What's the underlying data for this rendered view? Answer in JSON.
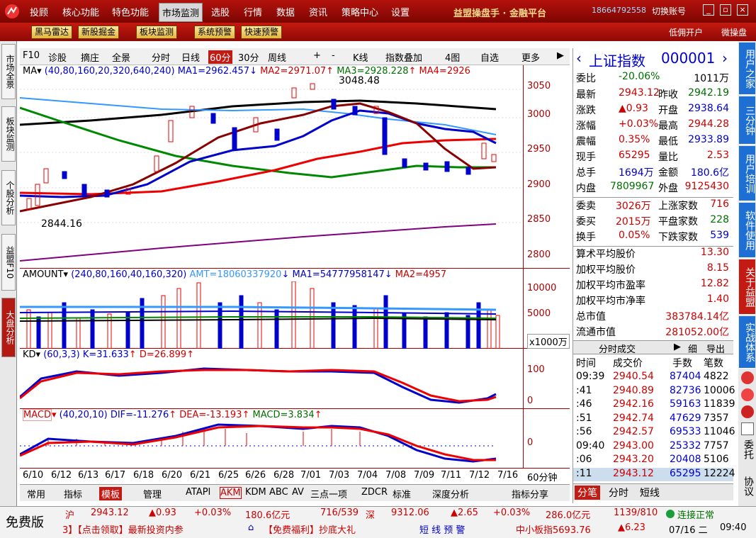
{
  "menu": {
    "items": [
      "投顾",
      "核心功能",
      "特色功能",
      "市场监测",
      "选股",
      "行情",
      "数据",
      "资讯",
      "策略中心",
      "设置"
    ],
    "brand": "益盟操盘手 · 金融平台",
    "phone": "18664792558",
    "switch": "切换账号"
  },
  "toolbar2": {
    "buttons": [
      "黑马雷达",
      "新股掘金",
      "板块监测",
      "系统预警",
      "快速预警"
    ],
    "right": [
      "低佣开户",
      "微操盘"
    ]
  },
  "lefttabs": [
    "市场全景",
    "板块监测",
    "个股分析",
    "益盟F10",
    "大盘分析"
  ],
  "charttool": {
    "items": [
      "F10",
      "诊股",
      "摘庄",
      "全景",
      "分时",
      "日线",
      "60分",
      "30分",
      "周线",
      "+",
      "-",
      "K线",
      "指数叠加",
      "4图",
      "自选",
      "更多"
    ]
  },
  "ma": {
    "label": "MA",
    "params": "(40,80,160,20,320,640,240)",
    "ma1": "MA1=2962.457",
    "ma2": "MA2=2971.07",
    "ma3": "MA3=2928.228",
    "ma4": "MA4=2926"
  },
  "price_axis": [
    "3050",
    "3000",
    "2950",
    "2900",
    "2850",
    "2800"
  ],
  "annot": {
    "high": "3048.48",
    "low": "2844.16"
  },
  "amount": {
    "label": "AMOUNT",
    "params": "(240,80,160,40,160,320)",
    "amt": "AMT=18060337920",
    "ma1": "MA1=54777958147",
    "ma2": "MA2=4957",
    "axis": [
      "10000",
      "5000"
    ],
    "unit": "x1000万"
  },
  "kd": {
    "label": "KD",
    "params": "(60,3,3)",
    "k": "K=31.633",
    "d": "D=26.899",
    "axis": [
      "100",
      "0"
    ]
  },
  "macd": {
    "label": "MACD",
    "params": "(40,20,10)",
    "dif": "DIF=-11.276",
    "dea": "DEA=-13.193",
    "macd": "MACD=3.834",
    "axis": [
      "0"
    ]
  },
  "dates": [
    "6/10",
    "6/12",
    "6/13",
    "6/17",
    "6/18",
    "6/20",
    "6/21",
    "6/25",
    "6/26",
    "6/28",
    "7/01",
    "7/03",
    "7/04",
    "7/08",
    "7/09",
    "7/11",
    "7/12",
    "7/16"
  ],
  "period": "60分钟",
  "chart_tabs": [
    "常用",
    "指标",
    "模板",
    "管理",
    "ATAPI",
    "AKM",
    "KDM",
    "ABC",
    "AV",
    "三点一项",
    "ZDCR",
    "标准",
    "深度分析",
    "指标分享"
  ],
  "quote": {
    "name": "上证指数",
    "code": "000001",
    "rows": [
      [
        "委比",
        "-20.06%",
        "",
        "1011万"
      ],
      [
        "最新",
        "2943.12",
        "昨收",
        "2942.19"
      ],
      [
        "涨跌",
        "▲0.93",
        "开盘",
        "2938.64"
      ],
      [
        "涨幅",
        "+0.03%",
        "最高",
        "2944.28"
      ],
      [
        "震幅",
        "0.35%",
        "最低",
        "2933.89"
      ],
      [
        "现手",
        "65295",
        "量比",
        "2.53"
      ],
      [
        "总手",
        "1694万",
        "金额",
        "180.6亿"
      ],
      [
        "内盘",
        "7809967",
        "外盘",
        "9125430"
      ],
      [
        "委卖",
        "3026万",
        "上涨家数",
        "716"
      ],
      [
        "委买",
        "2015万",
        "平盘家数",
        "228"
      ],
      [
        "换手",
        "0.05%",
        "下跌家数",
        "539"
      ]
    ],
    "stats": [
      [
        "算术平均股价",
        "13.30"
      ],
      [
        "加权平均股价",
        "8.15"
      ],
      [
        "加权平均市盈率",
        "12.82"
      ],
      [
        "加权平均市净率",
        "1.40"
      ],
      [
        "总市值",
        "383784.14亿"
      ],
      [
        "流通市值",
        "281052.00亿"
      ]
    ]
  },
  "ticks": {
    "title": "分时成交",
    "detail": "细",
    "export": "导出",
    "headers": [
      "时间",
      "成交价",
      "手数",
      "笔数"
    ],
    "rows": [
      [
        "09:39",
        "2940.54",
        "87404",
        "4822"
      ],
      [
        ":41",
        "2940.89",
        "82736",
        "10006"
      ],
      [
        ":46",
        "2942.16",
        "59163",
        "11839"
      ],
      [
        ":51",
        "2942.74",
        "47629",
        "7357"
      ],
      [
        ":56",
        "2942.57",
        "69533",
        "11046"
      ],
      [
        "09:40",
        "2943.00",
        "25332",
        "7757"
      ],
      [
        ":06",
        "2943.20",
        "20408",
        "5106"
      ],
      [
        ":11",
        "2943.12",
        "65295",
        "12224"
      ]
    ],
    "tabs": [
      "分笔",
      "分时",
      "短线"
    ]
  },
  "righttabs": [
    "用户之家",
    "三分钟",
    "用户培训",
    "软件使用",
    "关于益盟",
    "实战体系",
    "委托",
    "协议"
  ],
  "status": {
    "free": "免费版",
    "sh": "沪",
    "sh_price": "2943.12",
    "sh_chg": "▲0.93",
    "sh_pct": "+0.03%",
    "sh_amt": "180.6亿元",
    "sh_ud": "716/539",
    "sz": "深",
    "sz_price": "9312.06",
    "sz_chg": "▲2.65",
    "sz_pct": "+0.03%",
    "sz_amt": "286.0亿元",
    "sz_ud": "1139/810",
    "conn": "连接正常",
    "ticker": "3】【点击领取】最新投资内参",
    "promo": "【免费福利】抄底大礼",
    "warn": "短 线 预 警",
    "small": "中小板指5693.76",
    "small_chg": "▲6.23",
    "date": "07/16 二",
    "time": "09:40"
  }
}
